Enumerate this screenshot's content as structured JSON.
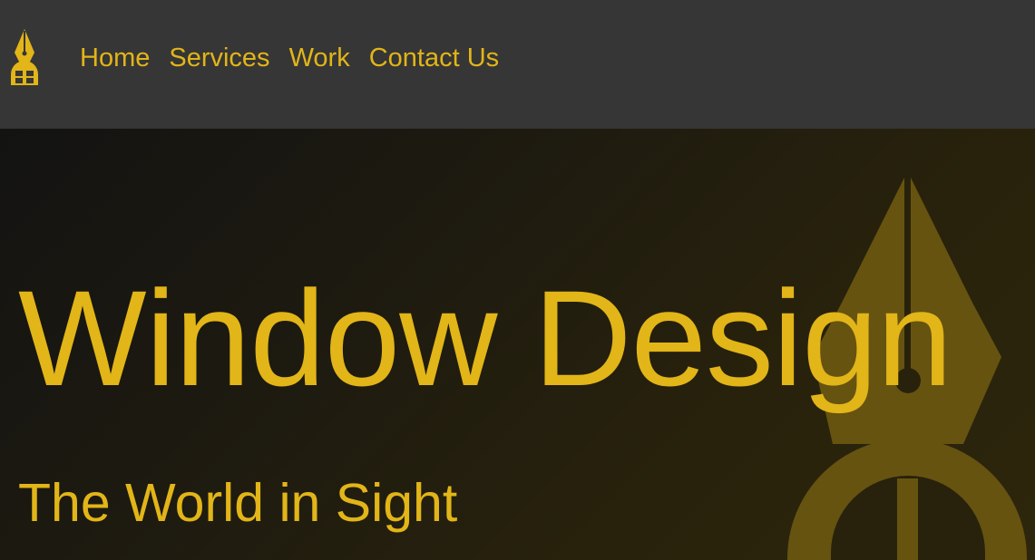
{
  "brand": {
    "logo_icon": "pen-nib-window-icon",
    "accent_color": "#e2b518",
    "header_color": "#363636"
  },
  "nav": {
    "items": [
      {
        "label": "Home"
      },
      {
        "label": "Services"
      },
      {
        "label": "Work"
      },
      {
        "label": "Contact Us"
      }
    ]
  },
  "hero": {
    "title": "Window Design",
    "subtitle": "The World in Sight",
    "background_icon": "pen-nib-window-icon"
  }
}
